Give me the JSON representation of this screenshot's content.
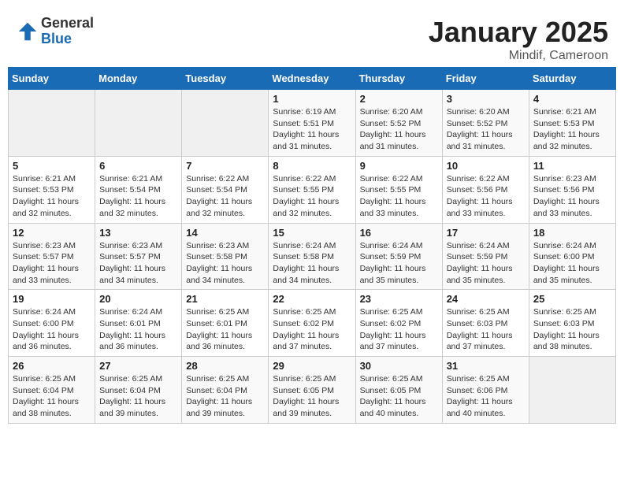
{
  "header": {
    "logo_general": "General",
    "logo_blue": "Blue",
    "title": "January 2025",
    "subtitle": "Mindif, Cameroon"
  },
  "days_of_week": [
    "Sunday",
    "Monday",
    "Tuesday",
    "Wednesday",
    "Thursday",
    "Friday",
    "Saturday"
  ],
  "weeks": [
    [
      {
        "day": "",
        "sunrise": "",
        "sunset": "",
        "daylight": ""
      },
      {
        "day": "",
        "sunrise": "",
        "sunset": "",
        "daylight": ""
      },
      {
        "day": "",
        "sunrise": "",
        "sunset": "",
        "daylight": ""
      },
      {
        "day": "1",
        "sunrise": "Sunrise: 6:19 AM",
        "sunset": "Sunset: 5:51 PM",
        "daylight": "Daylight: 11 hours and 31 minutes."
      },
      {
        "day": "2",
        "sunrise": "Sunrise: 6:20 AM",
        "sunset": "Sunset: 5:52 PM",
        "daylight": "Daylight: 11 hours and 31 minutes."
      },
      {
        "day": "3",
        "sunrise": "Sunrise: 6:20 AM",
        "sunset": "Sunset: 5:52 PM",
        "daylight": "Daylight: 11 hours and 31 minutes."
      },
      {
        "day": "4",
        "sunrise": "Sunrise: 6:21 AM",
        "sunset": "Sunset: 5:53 PM",
        "daylight": "Daylight: 11 hours and 32 minutes."
      }
    ],
    [
      {
        "day": "5",
        "sunrise": "Sunrise: 6:21 AM",
        "sunset": "Sunset: 5:53 PM",
        "daylight": "Daylight: 11 hours and 32 minutes."
      },
      {
        "day": "6",
        "sunrise": "Sunrise: 6:21 AM",
        "sunset": "Sunset: 5:54 PM",
        "daylight": "Daylight: 11 hours and 32 minutes."
      },
      {
        "day": "7",
        "sunrise": "Sunrise: 6:22 AM",
        "sunset": "Sunset: 5:54 PM",
        "daylight": "Daylight: 11 hours and 32 minutes."
      },
      {
        "day": "8",
        "sunrise": "Sunrise: 6:22 AM",
        "sunset": "Sunset: 5:55 PM",
        "daylight": "Daylight: 11 hours and 32 minutes."
      },
      {
        "day": "9",
        "sunrise": "Sunrise: 6:22 AM",
        "sunset": "Sunset: 5:55 PM",
        "daylight": "Daylight: 11 hours and 33 minutes."
      },
      {
        "day": "10",
        "sunrise": "Sunrise: 6:22 AM",
        "sunset": "Sunset: 5:56 PM",
        "daylight": "Daylight: 11 hours and 33 minutes."
      },
      {
        "day": "11",
        "sunrise": "Sunrise: 6:23 AM",
        "sunset": "Sunset: 5:56 PM",
        "daylight": "Daylight: 11 hours and 33 minutes."
      }
    ],
    [
      {
        "day": "12",
        "sunrise": "Sunrise: 6:23 AM",
        "sunset": "Sunset: 5:57 PM",
        "daylight": "Daylight: 11 hours and 33 minutes."
      },
      {
        "day": "13",
        "sunrise": "Sunrise: 6:23 AM",
        "sunset": "Sunset: 5:57 PM",
        "daylight": "Daylight: 11 hours and 34 minutes."
      },
      {
        "day": "14",
        "sunrise": "Sunrise: 6:23 AM",
        "sunset": "Sunset: 5:58 PM",
        "daylight": "Daylight: 11 hours and 34 minutes."
      },
      {
        "day": "15",
        "sunrise": "Sunrise: 6:24 AM",
        "sunset": "Sunset: 5:58 PM",
        "daylight": "Daylight: 11 hours and 34 minutes."
      },
      {
        "day": "16",
        "sunrise": "Sunrise: 6:24 AM",
        "sunset": "Sunset: 5:59 PM",
        "daylight": "Daylight: 11 hours and 35 minutes."
      },
      {
        "day": "17",
        "sunrise": "Sunrise: 6:24 AM",
        "sunset": "Sunset: 5:59 PM",
        "daylight": "Daylight: 11 hours and 35 minutes."
      },
      {
        "day": "18",
        "sunrise": "Sunrise: 6:24 AM",
        "sunset": "Sunset: 6:00 PM",
        "daylight": "Daylight: 11 hours and 35 minutes."
      }
    ],
    [
      {
        "day": "19",
        "sunrise": "Sunrise: 6:24 AM",
        "sunset": "Sunset: 6:00 PM",
        "daylight": "Daylight: 11 hours and 36 minutes."
      },
      {
        "day": "20",
        "sunrise": "Sunrise: 6:24 AM",
        "sunset": "Sunset: 6:01 PM",
        "daylight": "Daylight: 11 hours and 36 minutes."
      },
      {
        "day": "21",
        "sunrise": "Sunrise: 6:25 AM",
        "sunset": "Sunset: 6:01 PM",
        "daylight": "Daylight: 11 hours and 36 minutes."
      },
      {
        "day": "22",
        "sunrise": "Sunrise: 6:25 AM",
        "sunset": "Sunset: 6:02 PM",
        "daylight": "Daylight: 11 hours and 37 minutes."
      },
      {
        "day": "23",
        "sunrise": "Sunrise: 6:25 AM",
        "sunset": "Sunset: 6:02 PM",
        "daylight": "Daylight: 11 hours and 37 minutes."
      },
      {
        "day": "24",
        "sunrise": "Sunrise: 6:25 AM",
        "sunset": "Sunset: 6:03 PM",
        "daylight": "Daylight: 11 hours and 37 minutes."
      },
      {
        "day": "25",
        "sunrise": "Sunrise: 6:25 AM",
        "sunset": "Sunset: 6:03 PM",
        "daylight": "Daylight: 11 hours and 38 minutes."
      }
    ],
    [
      {
        "day": "26",
        "sunrise": "Sunrise: 6:25 AM",
        "sunset": "Sunset: 6:04 PM",
        "daylight": "Daylight: 11 hours and 38 minutes."
      },
      {
        "day": "27",
        "sunrise": "Sunrise: 6:25 AM",
        "sunset": "Sunset: 6:04 PM",
        "daylight": "Daylight: 11 hours and 39 minutes."
      },
      {
        "day": "28",
        "sunrise": "Sunrise: 6:25 AM",
        "sunset": "Sunset: 6:04 PM",
        "daylight": "Daylight: 11 hours and 39 minutes."
      },
      {
        "day": "29",
        "sunrise": "Sunrise: 6:25 AM",
        "sunset": "Sunset: 6:05 PM",
        "daylight": "Daylight: 11 hours and 39 minutes."
      },
      {
        "day": "30",
        "sunrise": "Sunrise: 6:25 AM",
        "sunset": "Sunset: 6:05 PM",
        "daylight": "Daylight: 11 hours and 40 minutes."
      },
      {
        "day": "31",
        "sunrise": "Sunrise: 6:25 AM",
        "sunset": "Sunset: 6:06 PM",
        "daylight": "Daylight: 11 hours and 40 minutes."
      },
      {
        "day": "",
        "sunrise": "",
        "sunset": "",
        "daylight": ""
      }
    ]
  ]
}
